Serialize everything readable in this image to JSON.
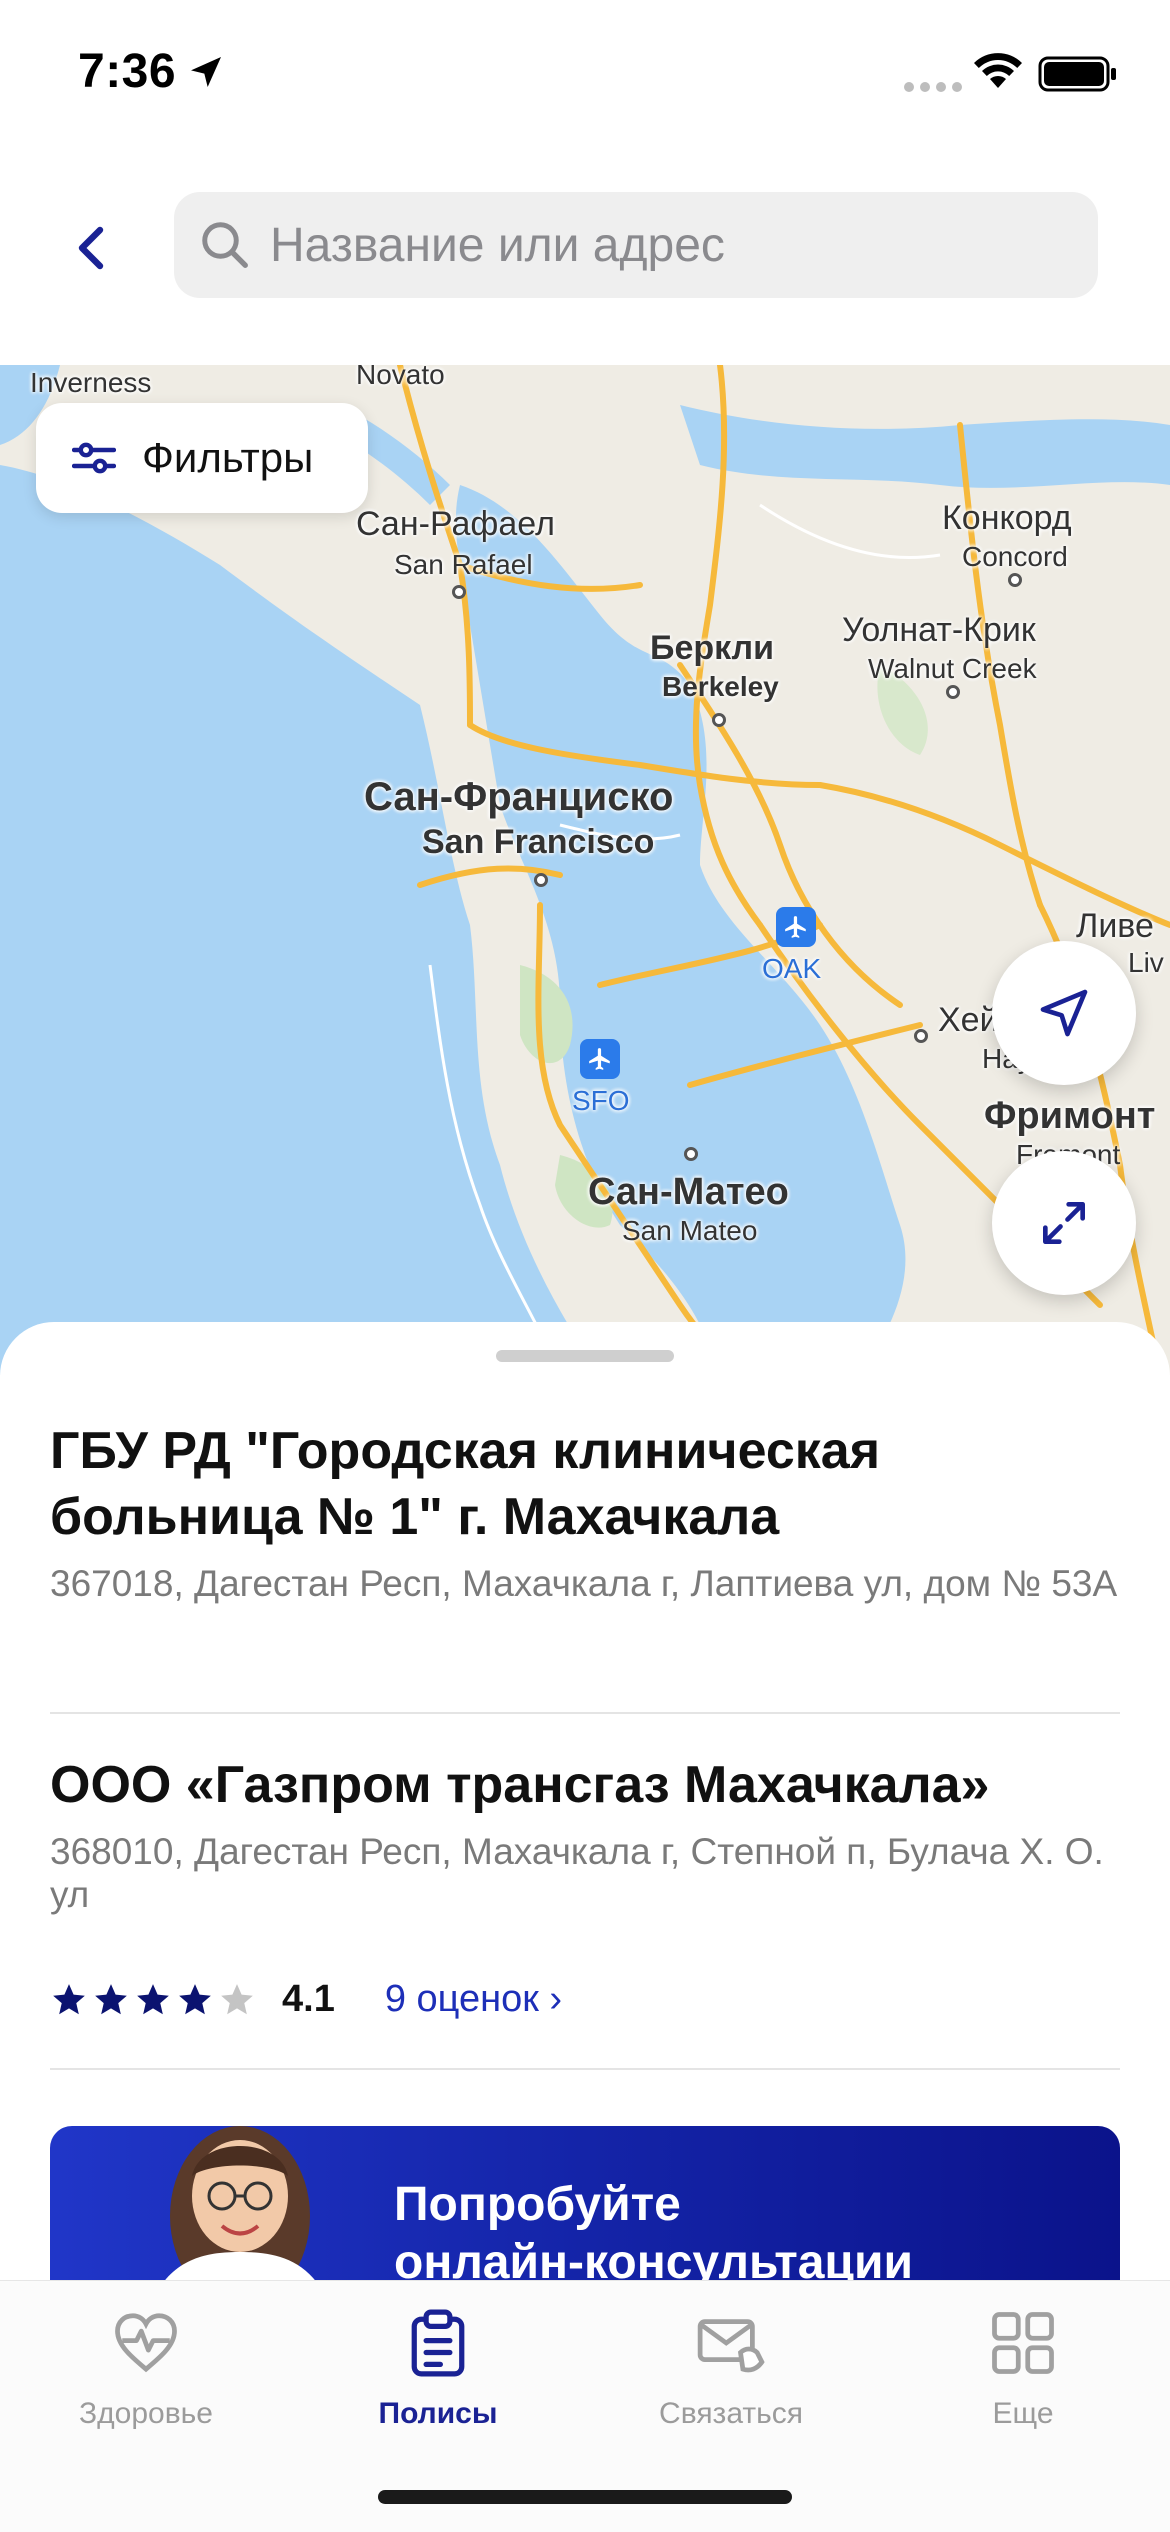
{
  "status_bar": {
    "time": "7:36"
  },
  "search": {
    "placeholder": "Название или адрес"
  },
  "map": {
    "filter_label": "Фильтры",
    "labels": {
      "inverness": "Inverness",
      "novato": "Novato",
      "san_rafael_ru": "Сан-Рафаел",
      "san_rafael_en": "San Rafael",
      "concord_ru": "Конкорд",
      "concord_en": "Concord",
      "walnut_creek_ru": "Уолнат-Крик",
      "walnut_creek_en": "Walnut Creek",
      "berkeley_ru": "Беркли",
      "berkeley_en": "Berkeley",
      "sf_ru": "Сан-Франциско",
      "sf_en": "San Francisco",
      "oak": "OAK",
      "sfo": "SFO",
      "livermore_ru": "Ливе",
      "livermore_en": "Liv",
      "hayward_ru": "Хей",
      "hayward_en": "Hayw",
      "fremont_ru": "Фримонт",
      "fremont_en": "Fremont",
      "san_mateo_ru": "Сан-Матео",
      "san_mateo_en": "San Mateo"
    }
  },
  "organizations": [
    {
      "title": "ГБУ РД \"Городская клиническая больница № 1\" г. Махачкала",
      "address": "367018, Дагестан Респ, Махачкала г, Лаптиева ул, дом № 53А"
    },
    {
      "title": "ООО «Газпром трансгаз Махачкала»",
      "address": "368010, Дагестан Респ, Махачкала г, Степной п, Булача Х. О. ул",
      "rating": 4.1,
      "rating_text": "4.1",
      "reviews": "9 оценок ›"
    }
  ],
  "promo": {
    "text": "Попробуйте\nонлайн-консультации"
  },
  "tabs": [
    {
      "label": "Здоровье",
      "icon": "heart-pulse-icon"
    },
    {
      "label": "Полисы",
      "icon": "clipboard-icon",
      "active": true
    },
    {
      "label": "Связаться",
      "icon": "envelope-phone-icon"
    },
    {
      "label": "Еще",
      "icon": "grid-icon"
    }
  ],
  "colors": {
    "accent": "#1a2294",
    "link": "#1d2fb8",
    "water": "#a9d3f4",
    "road": "#f6b93b",
    "promo_start": "#2036c8",
    "promo_end": "#0b138b"
  }
}
